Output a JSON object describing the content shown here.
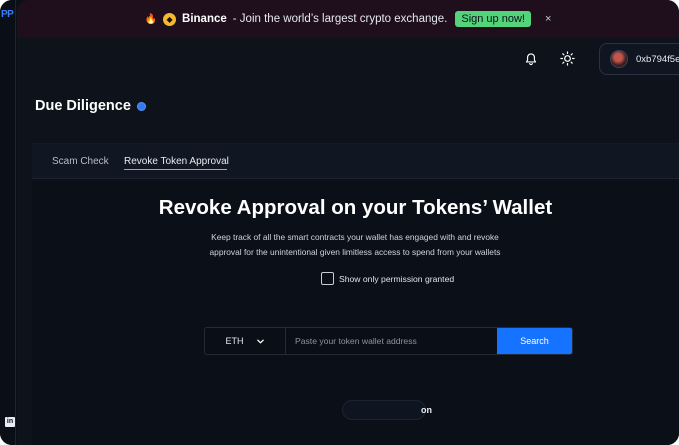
{
  "left_rail": {
    "logo_text": "PP",
    "linkedin_icon": "linkedin-icon"
  },
  "banner": {
    "fire_emoji": "🔥",
    "brand_icon": "binance-icon",
    "brand": "Binance",
    "message": "- Join the world’s largest crypto exchange.",
    "cta_label": "Sign up now!",
    "close_glyph": "×",
    "cta_color": "#53d37a"
  },
  "topbar": {
    "notification_icon": "bell-icon",
    "theme_icon": "sun-icon",
    "wallet_address": "0xb794f5e"
  },
  "page": {
    "title": "Due Diligence",
    "info_icon": "info-dot-icon"
  },
  "tabs": [
    {
      "label": "Scam Check",
      "active": false
    },
    {
      "label": "Revoke Token Approval",
      "active": true
    }
  ],
  "hero": {
    "title": "Revoke Approval on your Tokens’ Wallet",
    "subtitle": "Keep track of all the smart contracts your wallet has engaged with and revoke approval for the unintentional given limitless access to spend from your wallets"
  },
  "filter": {
    "checkbox_label": "Show only permission granted",
    "checked": false
  },
  "search": {
    "chain_selected": "ETH",
    "input_value": "",
    "input_placeholder": "Paste your token wallet address",
    "button_label": "Search",
    "accent_color": "#1673ff"
  },
  "loading": {
    "partial_text": "on"
  }
}
